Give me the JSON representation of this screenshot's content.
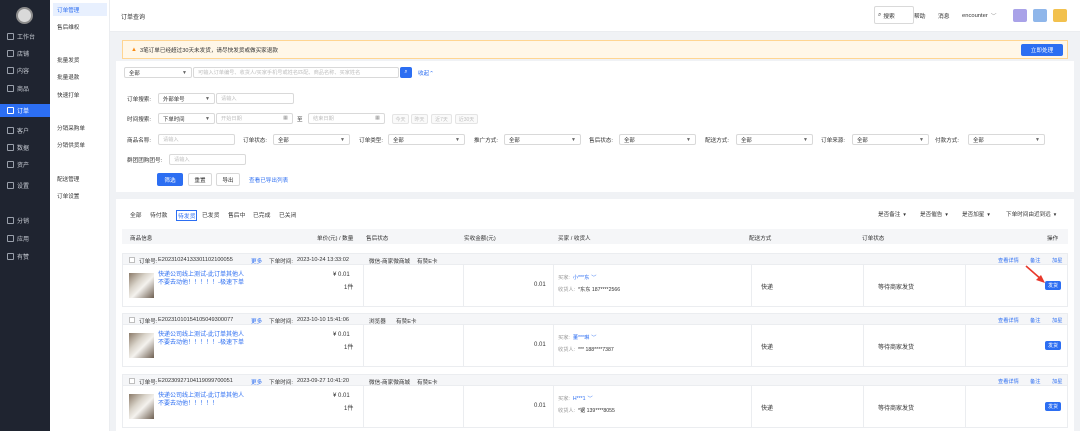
{
  "nav": {
    "items": [
      {
        "label": "工作台",
        "icon": "desktop-icon"
      },
      {
        "label": "店铺",
        "icon": "shop-icon"
      },
      {
        "label": "内容",
        "icon": "content-icon"
      },
      {
        "label": "商品",
        "icon": "goods-icon"
      },
      {
        "label": "订单",
        "icon": "order-icon"
      },
      {
        "label": "客户",
        "icon": "user-icon"
      },
      {
        "label": "数据",
        "icon": "chart-icon"
      },
      {
        "label": "资产",
        "icon": "asset-icon"
      },
      {
        "label": "设置",
        "icon": "gear-icon"
      },
      {
        "label": "分销",
        "icon": "distribution-icon"
      },
      {
        "label": "应用",
        "icon": "apps-icon"
      },
      {
        "label": "有赞",
        "icon": "youzan-icon"
      }
    ],
    "active_index": 4
  },
  "subnav": {
    "items": [
      "订单管理",
      "售后维权",
      "批量发货",
      "批量退款",
      "快速打单",
      "分销采购单",
      "分销供货单",
      "配送管理",
      "订单设置"
    ]
  },
  "header": {
    "breadcrumb": "订单查询",
    "search": "搜索",
    "help": "帮助",
    "message": "消息",
    "user": "encounter"
  },
  "notice": {
    "text": "3笔订单已经超过30天未发货，请尽快发货或做买家退款",
    "action": "立即处理"
  },
  "quick_search": {
    "scope": "全部",
    "placeholder": "可输入订单编号、收货人/买家手机号或姓名匹配、商品名称、买家姓名",
    "collapse": "收起"
  },
  "filters": {
    "order_search_label": "订单搜索:",
    "order_search_type": "外部单号",
    "order_search_placeholder": "请输入",
    "time_label": "时间搜索:",
    "time_type": "下单时间",
    "start_date": "开始日期",
    "range_sep": "至",
    "end_date": "结束日期",
    "quick_ranges": [
      "今天",
      "昨天",
      "近7天",
      "近30天"
    ],
    "goods_name_label": "商品名称:",
    "goods_name_placeholder": "请输入",
    "selects": [
      {
        "label": "订单状态:",
        "value": "全部"
      },
      {
        "label": "订单类型:",
        "value": "全部"
      },
      {
        "label": "推广方式:",
        "value": "全部"
      },
      {
        "label": "售后状态:",
        "value": "全部"
      },
      {
        "label": "配送方式:",
        "value": "全部"
      },
      {
        "label": "订单来源:",
        "value": "全部"
      },
      {
        "label": "付款方式:",
        "value": "全部"
      }
    ],
    "group_label": "群团团购团号:",
    "group_placeholder": "请输入",
    "buttons": {
      "filter": "筛选",
      "reset": "重置",
      "export": "导出",
      "view_export": "查看已导出列表"
    }
  },
  "tabs": [
    "全部",
    "待付款",
    "待发货",
    "已发货",
    "售后中",
    "已完成",
    "已关闭"
  ],
  "active_tab": 2,
  "list_filters": [
    "是否备注",
    "是否催告",
    "是否加星",
    "下单时间由近到远"
  ],
  "table_headers": [
    "商品信息",
    "单价(元) / 数量",
    "售后状态",
    "实收金额(元)",
    "买家 / 收货人",
    "配送方式",
    "订单状态",
    "操作"
  ],
  "orders": [
    {
      "order_no_label": "订单号:",
      "order_no": "E20231024133301102100055",
      "more": "更多",
      "time_label": "下单时间:",
      "time": "2023-10-24 13:33:02",
      "source": "微信-商家微商城",
      "card": "有赞E卡",
      "actions": [
        "查看详情",
        "备注",
        "加星"
      ],
      "goods_title": "快递公司线上测试-此订单其他人不要去动他！！！！！-极速下单",
      "price": "¥ 0.01",
      "qty": "1件",
      "paid": "0.01",
      "buyer_label": "买家:",
      "buyer": "小***东",
      "receiver_label": "收货人:",
      "receiver": "*东东 187****2566",
      "delivery": "快递",
      "status": "等待商家发货",
      "ship_button": "发货"
    },
    {
      "order_no_label": "订单号:",
      "order_no": "E20231010154105049300077",
      "more": "更多",
      "time_label": "下单时间:",
      "time": "2023-10-10 15:41:06",
      "source": "浏览器",
      "card": "有赞E卡",
      "actions": [
        "查看详情",
        "备注",
        "加星"
      ],
      "goods_title": "快递公司线上测试-此订单其他人不要去动他！！！！！-极速下单",
      "price": "¥ 0.01",
      "qty": "1件",
      "paid": "0.01",
      "buyer_label": "买家:",
      "buyer": "董***琳",
      "receiver_label": "收货人:",
      "receiver": "*** 188****7387",
      "delivery": "快递",
      "status": "等待商家发货",
      "ship_button": "发货"
    },
    {
      "order_no_label": "订单号:",
      "order_no": "E20230927104119099700051",
      "more": "更多",
      "time_label": "下单时间:",
      "time": "2023-09-27 10:41:20",
      "source": "微信-商家微商城",
      "card": "有赞E卡",
      "actions": [
        "查看详情",
        "备注",
        "加星"
      ],
      "goods_title": "快递公司线上测试-此订单其他人不要去动他！！！！！",
      "price": "¥ 0.01",
      "qty": "1件",
      "paid": "0.01",
      "buyer_label": "买家:",
      "buyer": "H***1",
      "receiver_label": "收货人:",
      "receiver": "*锯 139****8055",
      "delivery": "快递",
      "status": "等待商家发货",
      "ship_button": "发货"
    }
  ],
  "colors": {
    "primary": "#2c6ef2",
    "nav_bg": "#1f2430",
    "warning": "#fa8c16",
    "annotation_arrow": "#e8392c"
  }
}
